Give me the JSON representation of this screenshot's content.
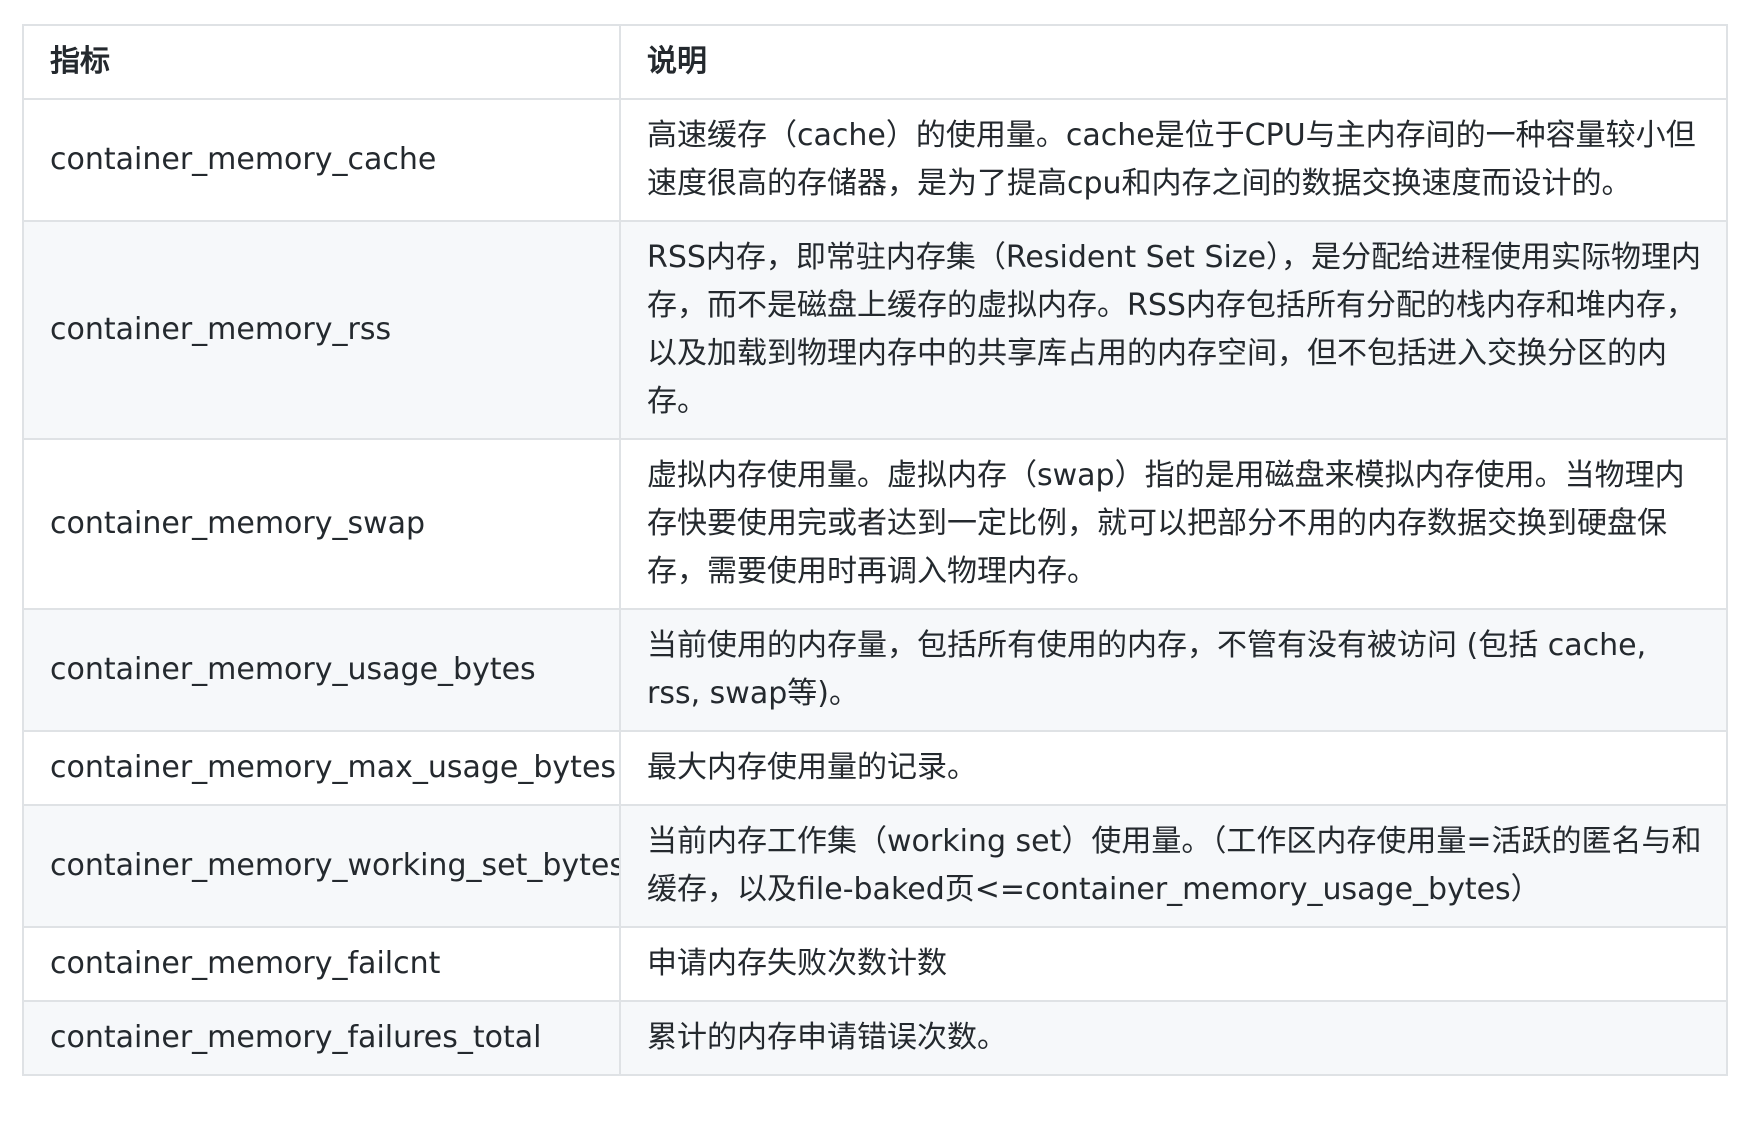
{
  "table": {
    "headers": [
      "指标",
      "说明"
    ],
    "rows": [
      {
        "metric": "container_memory_cache",
        "description": "高速缓存（cache）的使用量。cache是位于CPU与主内存间的一种容量较小但速度很高的存储器，是为了提高cpu和内存之间的数据交换速度而设计的。"
      },
      {
        "metric": "container_memory_rss",
        "description": "RSS内存，即常驻内存集（Resident Set Size），是分配给进程使用实际物理内存，而不是磁盘上缓存的虚拟内存。RSS内存包括所有分配的栈内存和堆内存，以及加载到物理内存中的共享库占用的内存空间，但不包括进入交换分区的内存。"
      },
      {
        "metric": "container_memory_swap",
        "description": "虚拟内存使用量。虚拟内存（swap）指的是用磁盘来模拟内存使用。当物理内存快要使用完或者达到一定比例，就可以把部分不用的内存数据交换到硬盘保存，需要使用时再调入物理内存。"
      },
      {
        "metric": "container_memory_usage_bytes",
        "description": "当前使用的内存量，包括所有使用的内存，不管有没有被访问 (包括 cache, rss, swap等)。"
      },
      {
        "metric": "container_memory_max_usage_bytes",
        "description": "最大内存使用量的记录。"
      },
      {
        "metric": "container_memory_working_set_bytes",
        "description": "当前内存工作集（working set）使用量。（工作区内存使用量=活跃的匿名与和缓存，以及file-baked页<=container_memory_usage_bytes）"
      },
      {
        "metric": "container_memory_failcnt",
        "description": "申请内存失败次数计数"
      },
      {
        "metric": "container_memory_failures_total",
        "description": "累计的内存申请错误次数。"
      }
    ]
  }
}
